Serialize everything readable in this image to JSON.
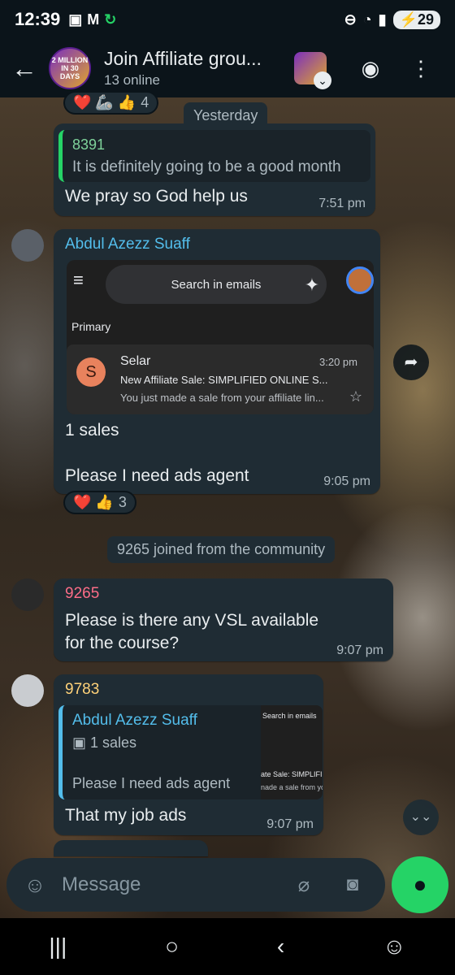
{
  "status": {
    "time": "12:39",
    "battery": "29",
    "left_icons": [
      "screenshot-icon",
      "gmail-icon",
      "sync-icon"
    ],
    "right_icons": [
      "do-not-disturb-icon",
      "wifi-icon",
      "signal-icon"
    ]
  },
  "header": {
    "title": "Join Affiliate grou...",
    "subtitle": "13 online",
    "avatar_text": "2 MILLION IN 30 DAYS"
  },
  "date_chip": "Yesterday",
  "top_reactions": {
    "emojis": "❤️ 🦾 👍",
    "count": "4"
  },
  "messages": [
    {
      "reply_sender": "8391",
      "reply_text": "It is definitely going to be a good month",
      "text": "We pray so God help us",
      "time": "7:51 pm"
    },
    {
      "sender": "Abdul Azezz Suaff",
      "embed": {
        "search_placeholder": "Search in emails",
        "section": "Primary",
        "mail_avatar": "S",
        "from": "Selar",
        "time": "3:20 pm",
        "subject": "New Affiliate Sale: SIMPLIFIED ONLINE S...",
        "snippet": "You just made a sale from your affiliate lin..."
      },
      "text_line1": "1 sales",
      "text_line2": "Please I need ads agent",
      "time": "9:05 pm",
      "reactions": {
        "emojis": "❤️ 👍",
        "count": "3"
      }
    },
    {
      "system": "9265 joined from the community"
    },
    {
      "sender": "9265",
      "text": "Please is there any VSL available for the course?",
      "time": "9:07 pm"
    },
    {
      "sender": "9783",
      "reply_sender": "Abdul Azezz Suaff",
      "reply_line1": "1 sales",
      "reply_line2": "Please I need ads agent",
      "reply_thumb_search": "Search in emails",
      "reply_thumb_sub": "ate Sale: SIMPLIFIED",
      "reply_thumb_snip": "nade a sale from your",
      "text": "That my job ads",
      "time": "9:07 pm"
    }
  ],
  "composer": {
    "placeholder": "Message"
  },
  "colors": {
    "accent": "#25d366",
    "bubble": "#1f2c34",
    "sender_blue": "#53bdeb",
    "sender_pink": "#fc6d87",
    "sender_yellow": "#ffd279",
    "sender_green": "#7fd39b"
  }
}
